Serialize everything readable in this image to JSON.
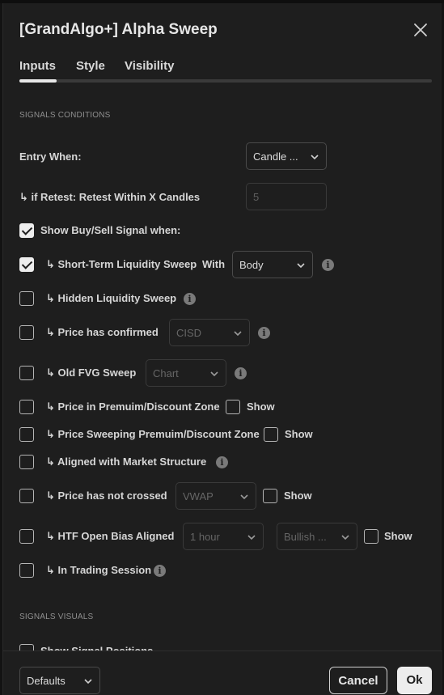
{
  "dialog": {
    "title": "[GrandAlgo+] Alpha Sweep",
    "tabs": [
      {
        "label": "Inputs",
        "active": true
      },
      {
        "label": "Style",
        "active": false
      },
      {
        "label": "Visibility",
        "active": false
      }
    ]
  },
  "signals_conditions": {
    "header": "SIGNALS CONDITIONS",
    "entry_when": {
      "label": "Entry When:",
      "value": "Candle ..."
    },
    "retest": {
      "label": "↳ if Retest: Retest Within X Candles",
      "value": "5"
    },
    "show_signal": {
      "label": "Show Buy/Sell Signal when:",
      "checked": true
    },
    "short_term": {
      "label": "↳ Short-Term Liquidity Sweep",
      "with_label": "With",
      "value": "Body",
      "checked": true
    },
    "hidden_sweep": {
      "label": "↳ Hidden Liquidity Sweep",
      "checked": false
    },
    "price_confirmed": {
      "label": "↳ Price has confirmed",
      "value": "CISD",
      "checked": false
    },
    "old_fvg": {
      "label": "↳ Old FVG Sweep",
      "value": "Chart",
      "checked": false
    },
    "premium_zone": {
      "label": "↳ Price in Premuim/Discount Zone",
      "show_label": "Show",
      "checked": false,
      "show_checked": false
    },
    "sweeping_zone": {
      "label": "↳ Price Sweeping Premuim/Discount Zone",
      "show_label": "Show",
      "checked": false,
      "show_checked": false
    },
    "market_structure": {
      "label": "↳ Aligned with Market Structure",
      "checked": false
    },
    "not_crossed": {
      "label": "↳ Price has not crossed",
      "value": "VWAP",
      "show_label": "Show",
      "checked": false,
      "show_checked": false
    },
    "htf_bias": {
      "label": "↳ HTF Open Bias Aligned",
      "timeframe": "1 hour",
      "bias": "Bullish ...",
      "show_label": "Show",
      "checked": false,
      "show_checked": false
    },
    "trading_session": {
      "label": "↳ In Trading Session",
      "checked": false
    }
  },
  "signals_visuals": {
    "header": "SIGNALS VISUALS",
    "show_positions": {
      "label": "Show Signal Positions",
      "checked": false
    }
  },
  "footer": {
    "defaults_label": "Defaults",
    "cancel_label": "Cancel",
    "ok_label": "Ok"
  },
  "icons": {
    "close": "close-icon",
    "chevron": "chevron-down-icon",
    "info": "info-icon"
  }
}
